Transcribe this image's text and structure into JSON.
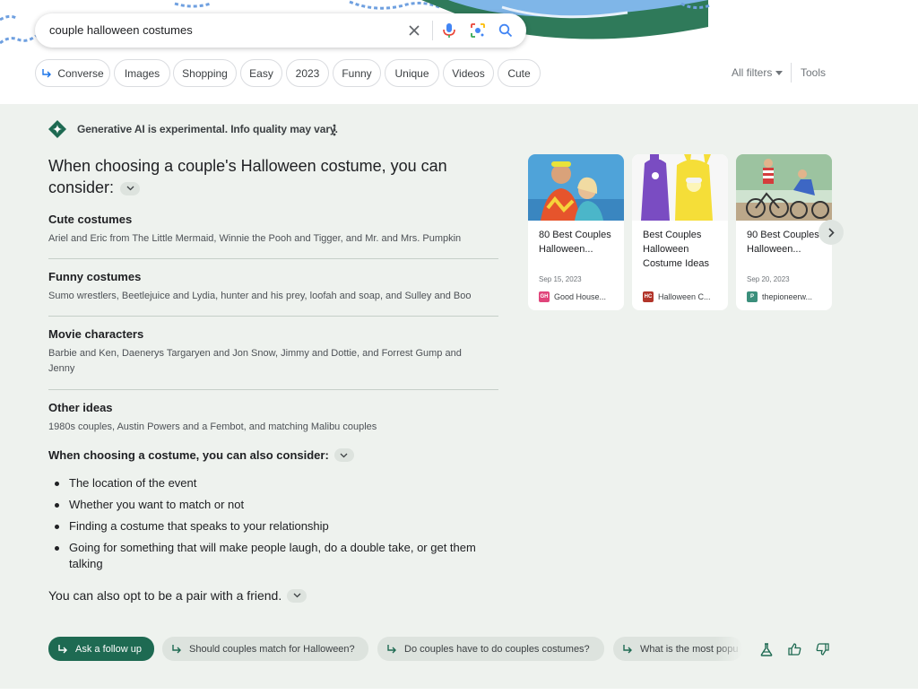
{
  "search": {
    "query": "couple halloween costumes"
  },
  "chips": [
    {
      "label": "Converse"
    },
    {
      "label": "Images"
    },
    {
      "label": "Shopping"
    },
    {
      "label": "Easy"
    },
    {
      "label": "2023"
    },
    {
      "label": "Funny"
    },
    {
      "label": "Unique"
    },
    {
      "label": "Videos"
    },
    {
      "label": "Cute"
    }
  ],
  "filters": {
    "all_filters": "All filters",
    "tools": "Tools"
  },
  "ai": {
    "notice": "Generative AI is experimental. Info quality may vary.",
    "intro": "When choosing a couple's Halloween costume, you can consider:",
    "sections": [
      {
        "title": "Cute costumes",
        "body": "Ariel and Eric from The Little Mermaid, Winnie the Pooh and Tigger, and Mr. and Mrs. Pumpkin"
      },
      {
        "title": "Funny costumes",
        "body": "Sumo wrestlers, Beetlejuice and Lydia, hunter and his prey, loofah and soap, and Sulley and Boo"
      },
      {
        "title": "Movie characters",
        "body": "Barbie and Ken, Daenerys Targaryen and Jon Snow, Jimmy and Dottie, and Forrest Gump and Jenny"
      },
      {
        "title": "Other ideas",
        "body": "1980s couples, Austin Powers and a Fembot, and matching Malibu couples"
      }
    ],
    "also_title": "When choosing a costume, you can also consider:",
    "bullets": [
      "The location of the event",
      "Whether you want to match or not",
      "Finding a costume that speaks to your relationship",
      "Going for something that will make people laugh, do a double take, or get them talking"
    ],
    "pair": "You can also opt to be a pair with a friend.",
    "cards": [
      {
        "title": "80 Best Couples Halloween...",
        "date": "Sep 15, 2023",
        "source": "Good House...",
        "favicon": "GH",
        "favicon_color": "#e0457b"
      },
      {
        "title": "Best Couples Halloween Costume Ideas",
        "date": "",
        "source": "Halloween C...",
        "favicon": "HC",
        "favicon_color": "#b2352a"
      },
      {
        "title": "90 Best Couples Halloween...",
        "date": "Sep 20, 2023",
        "source": "thepioneerw...",
        "favicon": "P",
        "favicon_color": "#3b8f7c"
      }
    ],
    "followups": [
      "Ask a follow up",
      "Should couples match for Halloween?",
      "Do couples have to do couples costumes?",
      "What is the most popu"
    ]
  },
  "colors": {
    "accent": "#1e6a52",
    "panel_bg": "#eef2ee",
    "chip_border": "#dadce0"
  },
  "icons": [
    "clear-icon",
    "mic-icon",
    "lens-icon",
    "search-icon",
    "reply-arrow-icon",
    "gemini-logo-icon",
    "more-vert-icon",
    "chevron-down-icon",
    "chevron-right-icon",
    "labs-icon",
    "thumbs-up-icon",
    "thumbs-down-icon"
  ]
}
